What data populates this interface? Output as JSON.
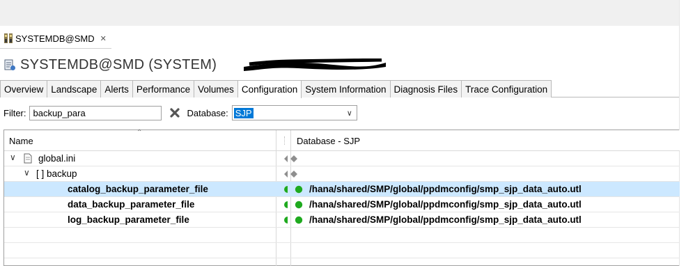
{
  "editor_tab": {
    "label": "SYSTEMDB@SMD",
    "close_icon": "close-icon"
  },
  "title": "SYSTEMDB@SMD (SYSTEM)",
  "tabs": [
    {
      "label": "Overview"
    },
    {
      "label": "Landscape"
    },
    {
      "label": "Alerts"
    },
    {
      "label": "Performance"
    },
    {
      "label": "Volumes"
    },
    {
      "label": "Configuration",
      "active": true
    },
    {
      "label": "System Information"
    },
    {
      "label": "Diagnosis Files"
    },
    {
      "label": "Trace Configuration"
    }
  ],
  "filter": {
    "label": "Filter:",
    "value": "backup_para"
  },
  "database": {
    "label": "Database:",
    "value": "SJP"
  },
  "grid": {
    "columns": {
      "name": "Name",
      "database": "Database - SJP"
    },
    "rows": [
      {
        "name": "global.ini",
        "value": "",
        "level": 0,
        "type": "file"
      },
      {
        "name": "[ ] backup",
        "value": "",
        "level": 1,
        "type": "section"
      },
      {
        "name": "catalog_backup_parameter_file",
        "value": "/hana/shared/SMP/global/ppdmconfig/smp_sjp_data_auto.utl",
        "level": 2,
        "type": "param",
        "selected": true
      },
      {
        "name": "data_backup_parameter_file",
        "value": "/hana/shared/SMP/global/ppdmconfig/smp_sjp_data_auto.utl",
        "level": 2,
        "type": "param"
      },
      {
        "name": "log_backup_parameter_file",
        "value": "/hana/shared/SMP/global/ppdmconfig/smp_sjp_data_auto.utl",
        "level": 2,
        "type": "param"
      }
    ]
  },
  "colors": {
    "selection": "#cce8ff",
    "status_green": "#1faa1f",
    "active_select": "#0078d7"
  }
}
